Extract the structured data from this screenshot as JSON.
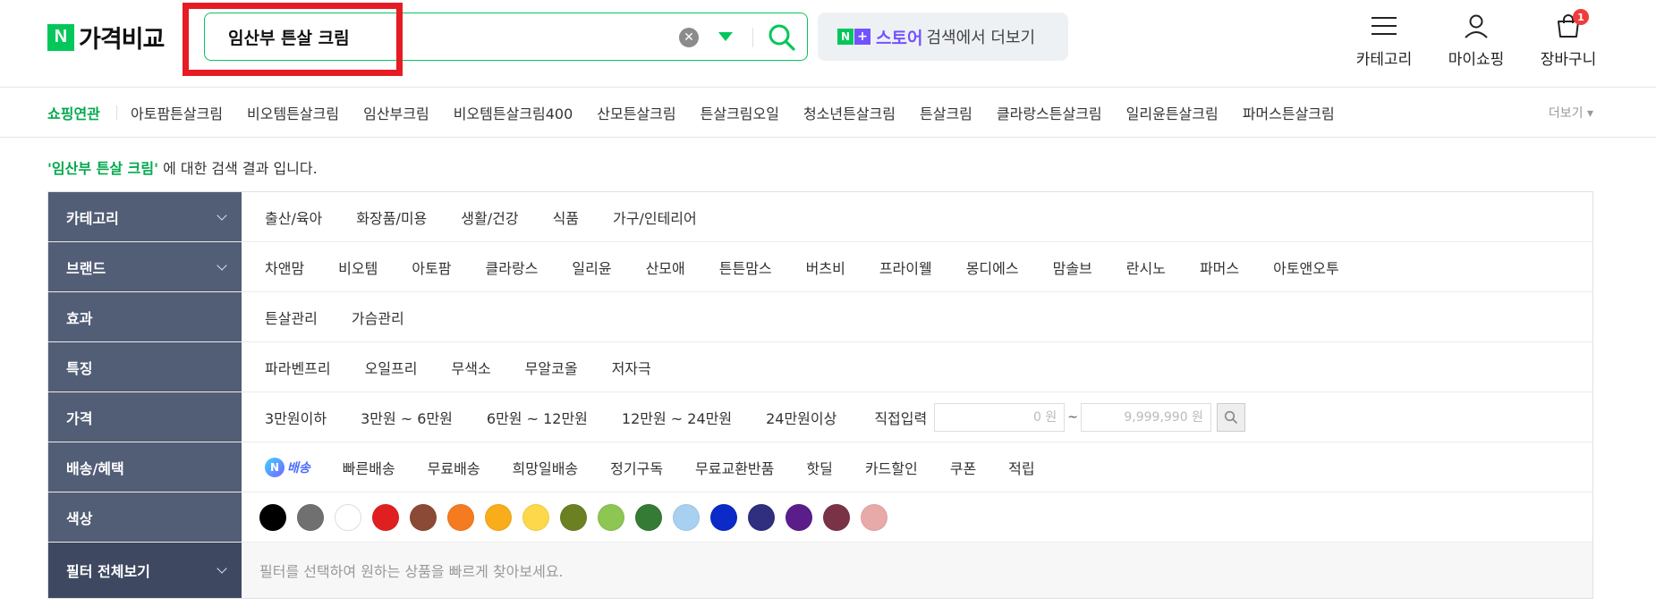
{
  "header": {
    "logo_mark": "N",
    "logo_text": "가격비교",
    "search": {
      "value": "임산부 튼살 크림",
      "clear_symbol": "✕"
    },
    "store_banner": {
      "n_mark": "N",
      "plus_mark": "+",
      "name": "스토어",
      "more": "검색에서 더보기"
    },
    "utils": [
      {
        "label": "카테고리",
        "icon": "menu-icon"
      },
      {
        "label": "마이쇼핑",
        "icon": "user-icon"
      },
      {
        "label": "장바구니",
        "icon": "cart-icon",
        "badge": "1"
      }
    ]
  },
  "related": {
    "title": "쇼핑연관",
    "items": [
      "아토팜튼살크림",
      "비오템튼살크림",
      "임산부크림",
      "비오템튼살크림400",
      "산모튼살크림",
      "튼살크림오일",
      "청소년튼살크림",
      "튼살크림",
      "클라랑스튼살크림",
      "일리윤튼살크림",
      "파머스튼살크림"
    ],
    "more": "더보기 ▾"
  },
  "notice": {
    "query": "'임산부 튼살 크림'",
    "suffix": " 에 대한 검색 결과 입니다."
  },
  "filters": {
    "category": {
      "label": "카테고리",
      "options": [
        "출산/육아",
        "화장품/미용",
        "생활/건강",
        "식품",
        "가구/인테리어"
      ]
    },
    "brand": {
      "label": "브랜드",
      "options": [
        "차앤맘",
        "비오템",
        "아토팜",
        "클라랑스",
        "일리윤",
        "산모애",
        "튼튼맘스",
        "버츠비",
        "프라이웰",
        "몽디에스",
        "맘솔브",
        "란시노",
        "파머스",
        "아토앤오투"
      ]
    },
    "effect": {
      "label": "효과",
      "options": [
        "튼살관리",
        "가슴관리"
      ]
    },
    "feature": {
      "label": "특징",
      "options": [
        "파라벤프리",
        "오일프리",
        "무색소",
        "무알코올",
        "저자극"
      ]
    },
    "price": {
      "label": "가격",
      "options": [
        "3만원이하",
        "3만원 ~ 6만원",
        "6만원 ~ 12만원",
        "12만원 ~ 24만원",
        "24만원이상"
      ],
      "direct_label": "직접입력",
      "min_value": "0 원",
      "max_value": "9,999,990 원",
      "tilde": "~"
    },
    "delivery": {
      "label": "배송/혜택",
      "badge_mark": "N",
      "badge_text": "배송",
      "options": [
        "빠른배송",
        "무료배송",
        "희망일배송",
        "정기구독",
        "무료교환반품",
        "핫딜",
        "카드할인",
        "쿠폰",
        "적립"
      ]
    },
    "color": {
      "label": "색상",
      "swatches": [
        "#000000",
        "#707070",
        "#ffffff",
        "#e02020",
        "#8b4a35",
        "#f47b20",
        "#f9ad1a",
        "#fdd84a",
        "#6b8023",
        "#8dc653",
        "#357b35",
        "#a8d0f0",
        "#0b2ac7",
        "#2f2e7f",
        "#5a1d8a",
        "#7a3346",
        "#e8aaa8"
      ]
    },
    "all": {
      "label": "필터 전체보기",
      "hint": "필터를 선택하여 원하는 상품을 빠르게 찾아보세요."
    }
  }
}
